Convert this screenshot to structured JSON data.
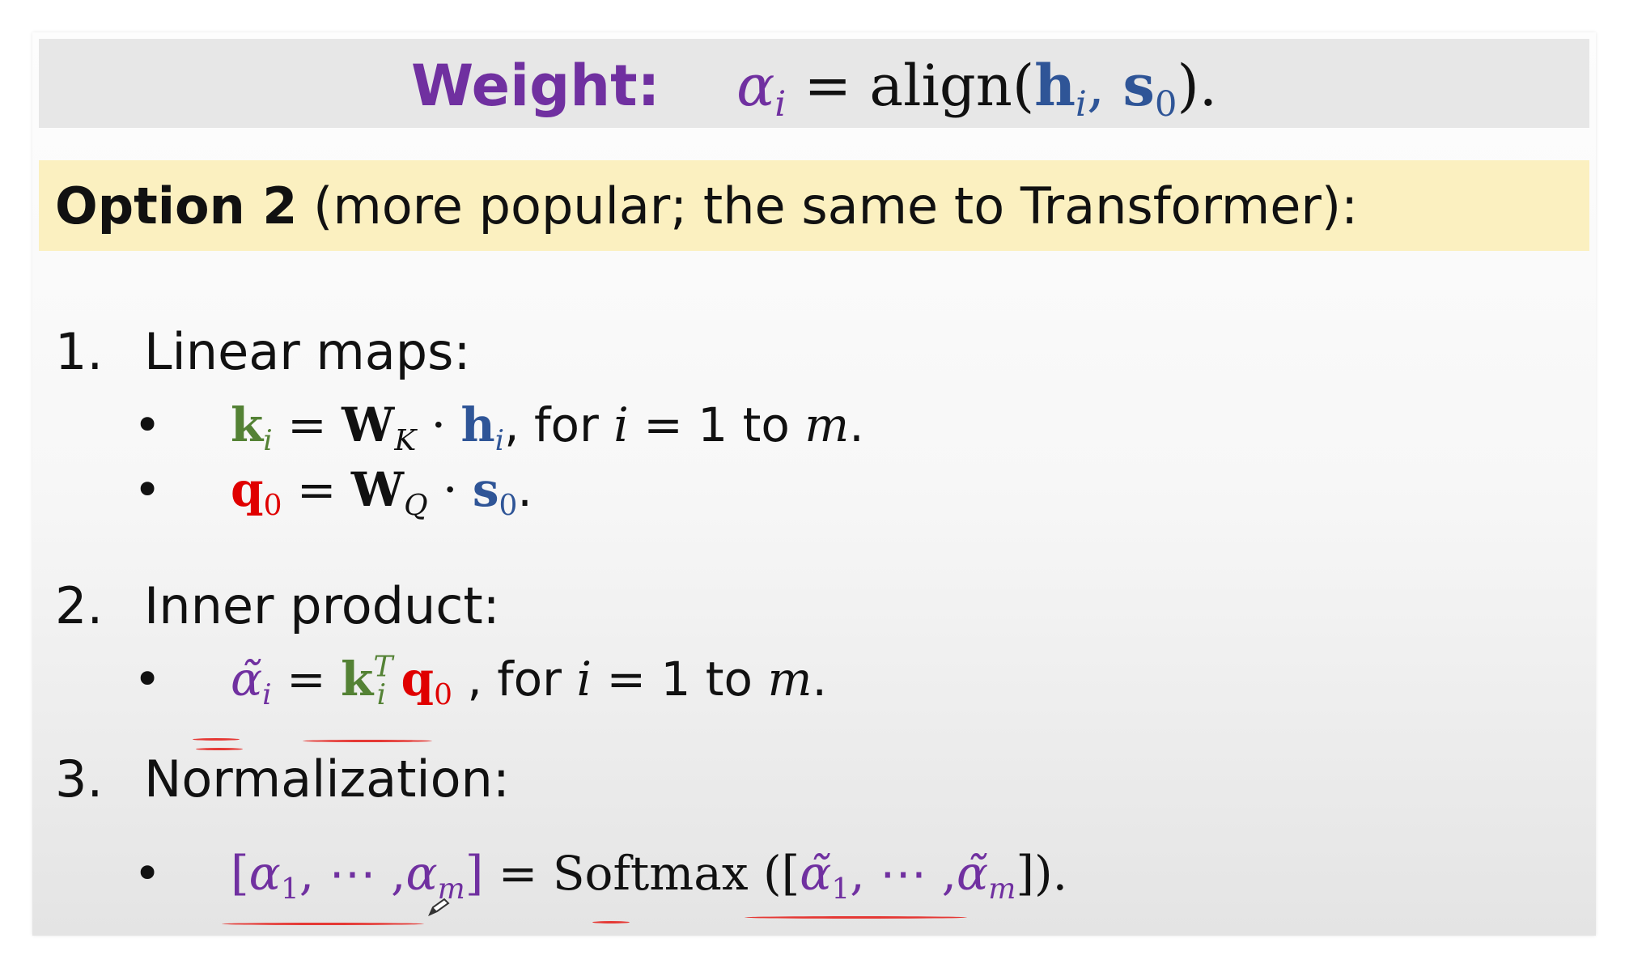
{
  "title": {
    "label": "Weight:",
    "formula": {
      "lhs": "α",
      "lhs_sub": "i",
      "eq": "=",
      "func": "align(",
      "arg1": "h",
      "arg1_sub": "i",
      "comma": ",",
      "arg2": "s",
      "arg2_sub": "0",
      "end": ")."
    }
  },
  "option": {
    "bold": "Option 2",
    "rest": "(more popular; the same to Transformer):"
  },
  "items": [
    {
      "num": "1.",
      "label": "Linear maps:",
      "bullets": [
        {
          "dot": "•",
          "k": "k",
          "k_sub": "i",
          "eq": "=",
          "W": "W",
          "W_sub": "K",
          "dot_op": "·",
          "h": "h",
          "h_sub": "i",
          "tail_prefix": ", for",
          "var": "i",
          "tail_eq": "= 1 to",
          "var2": "m",
          "end": "."
        },
        {
          "dot": "•",
          "q": "q",
          "q_sub": "0",
          "eq": "=",
          "W": "W",
          "W_sub": "Q",
          "dot_op": "·",
          "s": "s",
          "s_sub": "0",
          "end": "."
        }
      ]
    },
    {
      "num": "2.",
      "label": "Inner product:",
      "bullets": [
        {
          "dot": "•",
          "a": "α̃",
          "a_sub": "i",
          "eq": "=",
          "k": "k",
          "k_sub": "i",
          "k_sup": "T",
          "q": "q",
          "q_sub": "0",
          "tail_prefix": ", for",
          "var": "i",
          "tail_eq": "= 1 to",
          "var2": "m",
          "end": "."
        }
      ]
    },
    {
      "num": "3.",
      "label": "Normalization:",
      "bullets": [
        {
          "dot": "•",
          "lhs_open": "[",
          "a1": "α",
          "a1_sub": "1",
          "sep": ", ⋯ ,",
          "am": "α",
          "am_sub": "m",
          "lhs_close": "]",
          "eq": "=",
          "func": "Softmax",
          "open": "([",
          "t1": "α̃",
          "t1_sub": "1",
          "tsep": ", ⋯ ,",
          "tm": "α̃",
          "tm_sub": "m",
          "close": "]).",
          "_": ""
        }
      ]
    }
  ],
  "icons": {
    "pen": "pen-cursor-icon"
  },
  "colors": {
    "purple": "#7030a0",
    "blue": "#2f5597",
    "green": "#548235",
    "red": "#e00000",
    "highlight": "#fbf0c0",
    "annotation": "#e53935"
  }
}
